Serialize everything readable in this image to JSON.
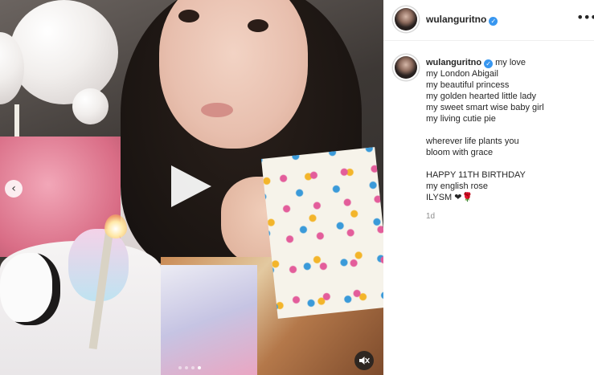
{
  "post": {
    "username": "wulanguritno",
    "verified": true
  },
  "media": {
    "type": "video",
    "carousel_total": 4,
    "carousel_active": 4
  },
  "caption": {
    "username": "wulanguritno",
    "lines": [
      "my love",
      "my London Abigail",
      "my beautiful princess",
      "my golden hearted little lady",
      "my sweet smart wise baby girl",
      "my living cutie pie",
      "",
      "wherever life plants you",
      "bloom with grace",
      "",
      "HAPPY 11TH BIRTHDAY",
      "my english rose",
      "ILYSM"
    ],
    "emojis": [
      "black-heart",
      "rose"
    ],
    "emoji_heart": "❤",
    "emoji_rose": "🌹"
  },
  "timestamp": "1d",
  "icons": {
    "play": "play-icon",
    "prev": "chevron-left-icon",
    "mute": "muted-speaker-icon",
    "more": "more-horizontal-icon",
    "verified": "verified-badge-icon"
  },
  "colors": {
    "verified_blue": "#3897f0",
    "text": "#262626",
    "muted_text": "#8e8e8e"
  }
}
